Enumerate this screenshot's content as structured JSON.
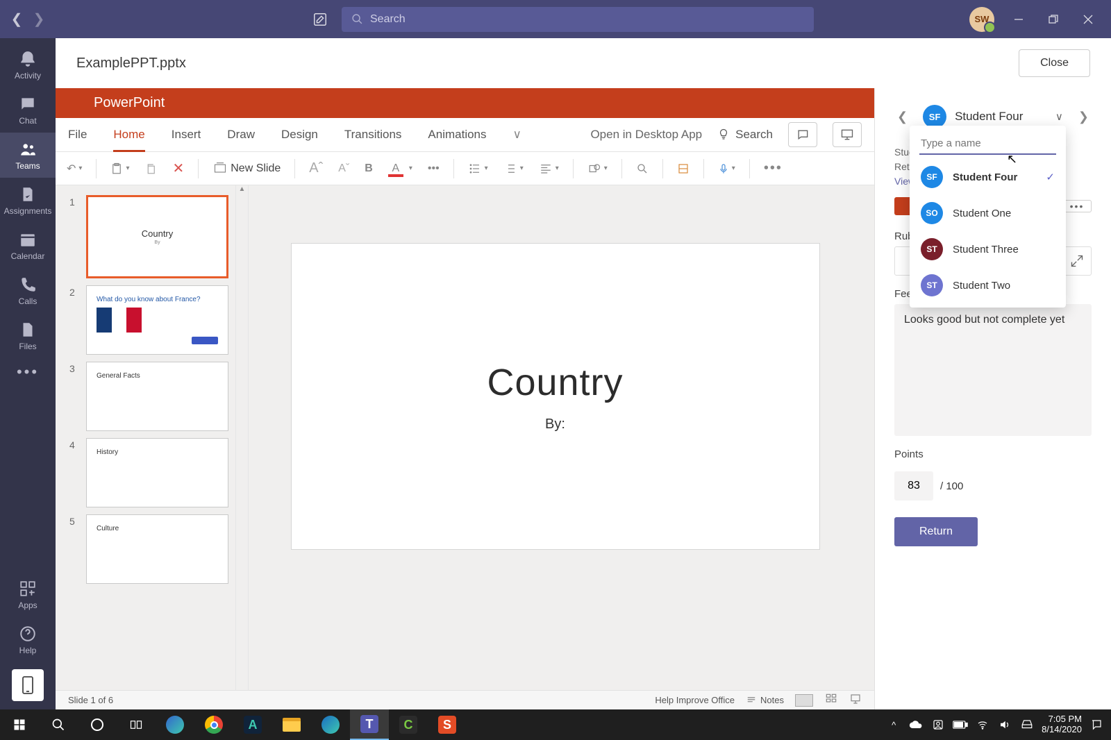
{
  "titlebar": {
    "search_placeholder": "Search",
    "avatar_initials": "SW"
  },
  "rail": {
    "activity": "Activity",
    "chat": "Chat",
    "teams": "Teams",
    "assignments": "Assignments",
    "calendar": "Calendar",
    "calls": "Calls",
    "files": "Files",
    "apps": "Apps",
    "help": "Help"
  },
  "file": {
    "name": "ExamplePPT.pptx",
    "close": "Close"
  },
  "powerpoint": {
    "brand": "PowerPoint",
    "tabs": {
      "file": "File",
      "home": "Home",
      "insert": "Insert",
      "draw": "Draw",
      "design": "Design",
      "transitions": "Transitions",
      "animations": "Animations",
      "open_desktop": "Open in Desktop App",
      "search": "Search"
    },
    "toolbar": {
      "new_slide": "New Slide"
    },
    "slides": [
      {
        "n": "1",
        "title": "Country",
        "sub": "By"
      },
      {
        "n": "2",
        "title": "What do you know about France?"
      },
      {
        "n": "3",
        "title": "General Facts"
      },
      {
        "n": "4",
        "title": "History"
      },
      {
        "n": "5",
        "title": "Culture"
      }
    ],
    "canvas": {
      "title": "Country",
      "byline": "By:"
    },
    "statusbar": {
      "slide": "Slide 1 of 6",
      "improve": "Help Improve Office",
      "notes": "Notes"
    }
  },
  "grading": {
    "current": {
      "initials": "SF",
      "name": "Student Four"
    },
    "search_placeholder": "Type a name",
    "students": [
      {
        "init": "SF",
        "name": "Student Four",
        "color": "#1e88e5",
        "selected": true
      },
      {
        "init": "SO",
        "name": "Student One",
        "color": "#1e88e5"
      },
      {
        "init": "ST",
        "name": "Student Three",
        "color": "#7a1f2b"
      },
      {
        "init": "ST",
        "name": "Student Two",
        "color": "#6e74d0"
      }
    ],
    "labels": {
      "student_work": "Student work",
      "returned": "Returned",
      "view": "View",
      "rubric": "Rubric",
      "feedback": "Feedback",
      "points": "Points"
    },
    "feedback_value": "Looks good but not complete yet",
    "points_value": "83",
    "points_total": "/ 100",
    "return": "Return"
  },
  "taskbar": {
    "time": "7:05 PM",
    "date": "8/14/2020"
  }
}
